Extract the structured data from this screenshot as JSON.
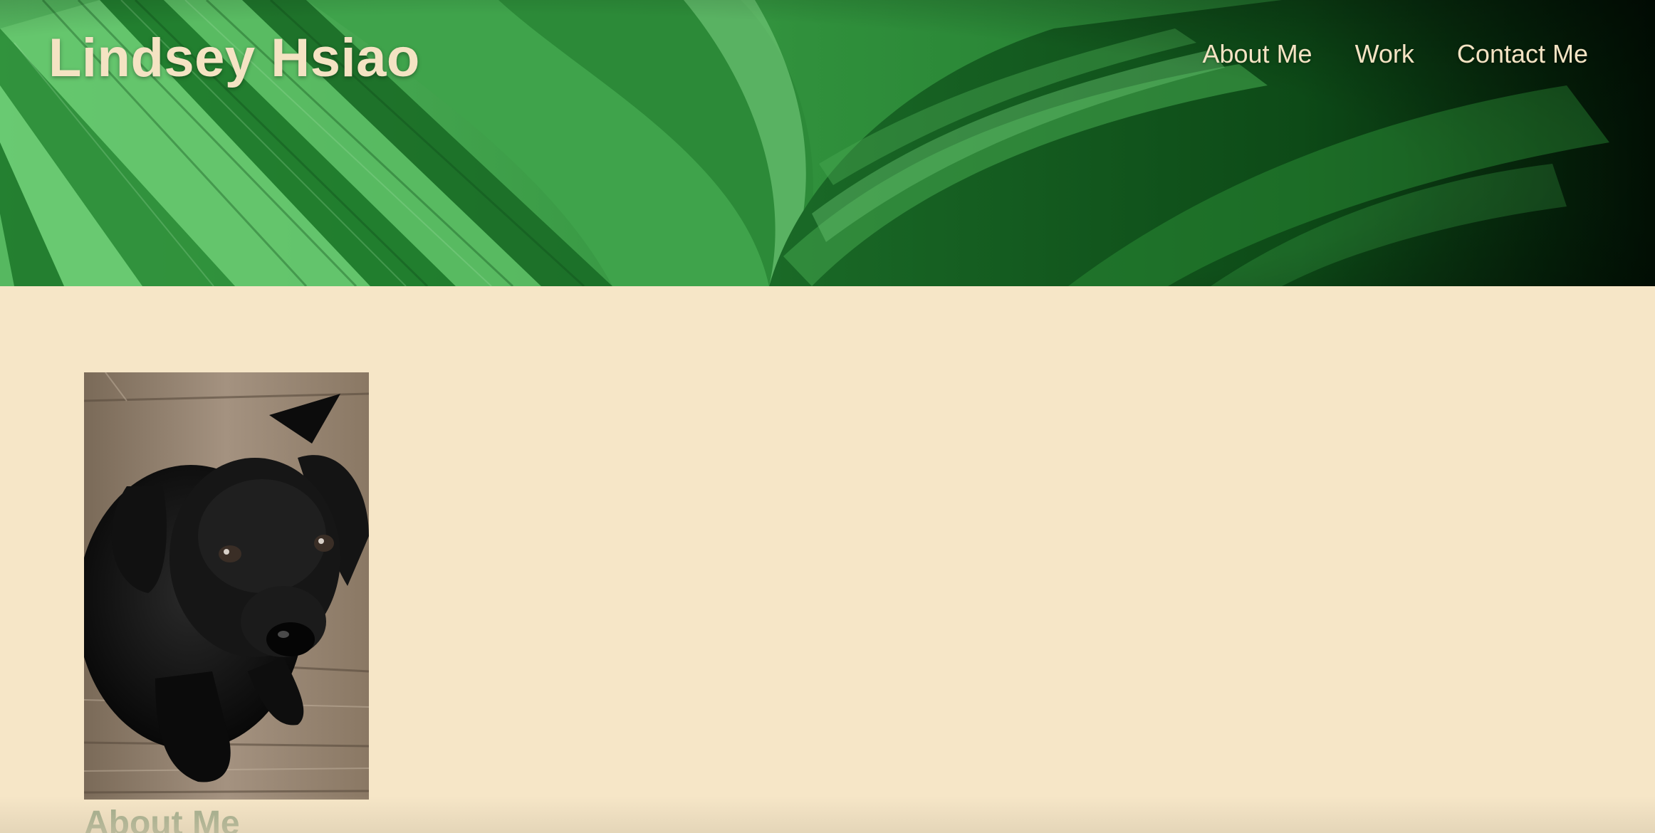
{
  "header": {
    "brand_name": "Lindsey Hsiao",
    "nav": {
      "about": "About Me",
      "work": "Work",
      "contact": "Contact Me"
    }
  },
  "hero": {
    "image": "green-leaves-banner"
  },
  "about": {
    "photo": "black-puppy-photo",
    "heading": "About Me"
  },
  "colors": {
    "cream_background": "#f6e6c7",
    "header_text": "#f4e3c3",
    "heading_green": "#9aa886",
    "leaf_green": "#2e8f3a",
    "leaf_dark": "#062b0c"
  }
}
